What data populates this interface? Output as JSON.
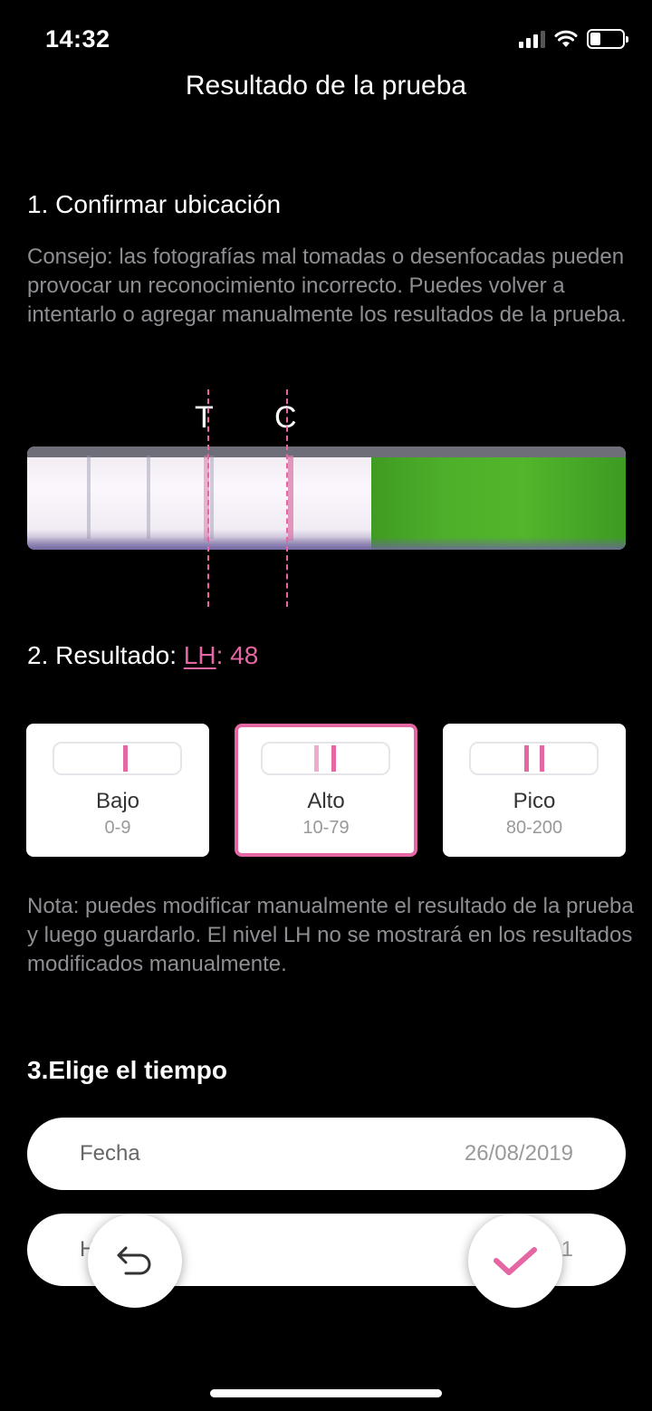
{
  "status_bar": {
    "time": "14:32"
  },
  "header": {
    "title": "Resultado de la prueba"
  },
  "location": {
    "title": "1. Confirmar ubicación",
    "tip": "Consejo: las fotografías mal tomadas o desenfocadas pueden provocar un reconocimiento incorrecto. Puedes volver a intentarlo o agregar manualmente los resultados de la prueba.",
    "markers": {
      "t": "T",
      "c": "C"
    }
  },
  "result": {
    "prefix": "2. Resultado: ",
    "lh_label": "LH",
    "separator": ": ",
    "lh_value": "48",
    "accent_color": "#e466a3",
    "levels": [
      {
        "label": "Bajo",
        "range": "0-9",
        "selected": false
      },
      {
        "label": "Alto",
        "range": "10-79",
        "selected": true
      },
      {
        "label": "Pico",
        "range": "80-200",
        "selected": false
      }
    ],
    "note": "Nota: puedes modificar manualmente el resultado de la prueba y luego guardarlo. El nivel LH no se mostrará en los resultados modificados manualmente."
  },
  "time": {
    "title": "3.Elige el tiempo",
    "date_label": "Fecha",
    "date_value": "26/08/2019",
    "hour_label_partial": "H",
    "hour_value_partial": "1"
  },
  "actions": {
    "undo_icon": "undo-icon",
    "confirm_icon": "check-icon"
  }
}
